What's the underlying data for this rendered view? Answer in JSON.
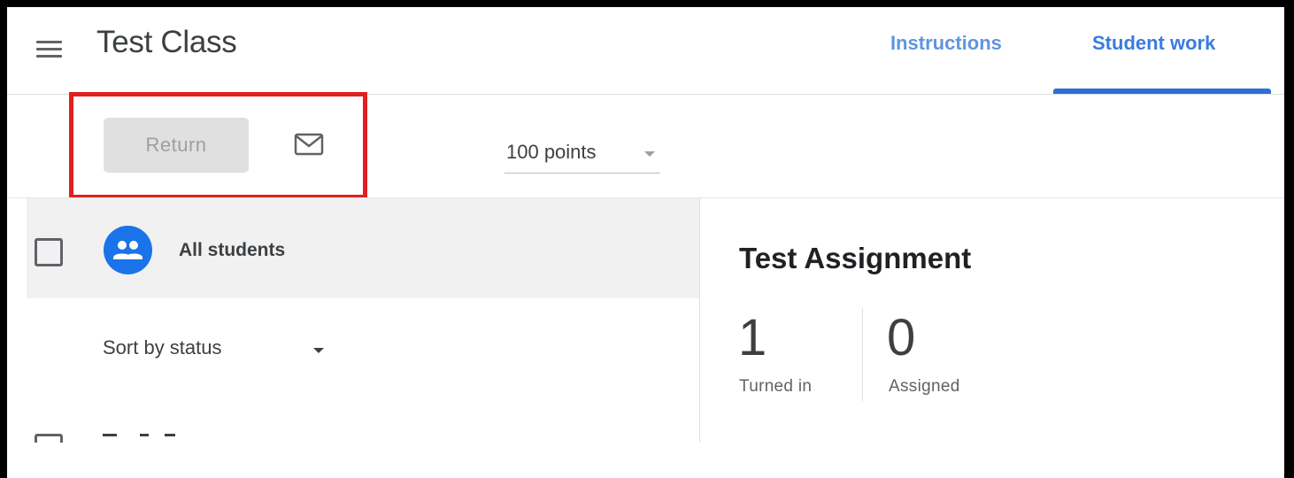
{
  "header": {
    "class_title": "Test Class",
    "tabs": [
      {
        "label": "Instructions",
        "active": false
      },
      {
        "label": "Student work",
        "active": true
      }
    ],
    "accent_color": "#1a73e8"
  },
  "toolbar": {
    "return_label": "Return",
    "return_enabled": false,
    "email_icon": "mail-icon",
    "points_value": "100 points",
    "highlight_color": "#e02020"
  },
  "student_list": {
    "all_students_label": "All students",
    "all_students_icon": "people-icon",
    "sort_label": "Sort by status"
  },
  "assignment": {
    "title": "Test Assignment",
    "stats": [
      {
        "count": "1",
        "label": "Turned in"
      },
      {
        "count": "0",
        "label": "Assigned"
      }
    ]
  }
}
